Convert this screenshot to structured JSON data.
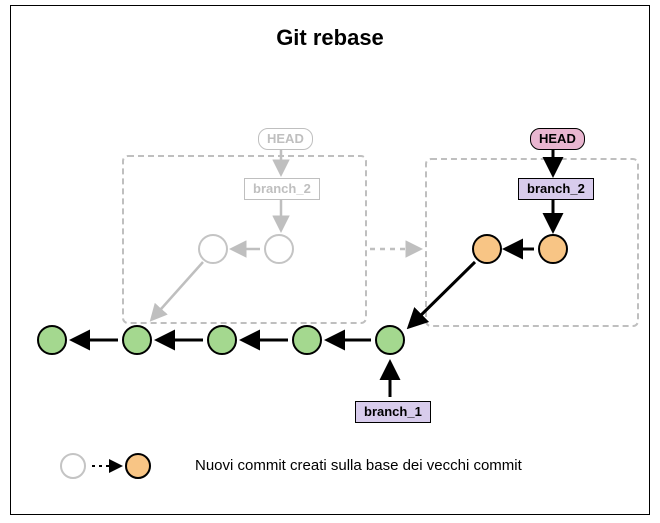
{
  "title": "Git rebase",
  "labels": {
    "head_old": "HEAD",
    "head_new": "HEAD",
    "branch2_old": "branch_2",
    "branch2_new": "branch_2",
    "branch1": "branch_1"
  },
  "legend": {
    "caption": "Nuovi commit creati sulla base dei vecchi commit"
  },
  "diagram": {
    "description": "Git rebase diagram: a linear green branch of five commits (branch_1 tip at the rightmost green). The old branch_2 (two ghost commits in left dashed box) was based on an earlier green commit; after rebase, two new orange commits replay branch_2 on top of branch_1's tip inside the right dashed box. HEAD points to branch_2 (new).",
    "commit_chain_main": [
      "c1",
      "c2",
      "c3",
      "c4",
      "c5"
    ],
    "old_branch2_commits": [
      "old_a",
      "old_b"
    ],
    "new_branch2_commits": [
      "new_a",
      "new_b"
    ],
    "old_base": "c2",
    "new_base": "c5"
  }
}
